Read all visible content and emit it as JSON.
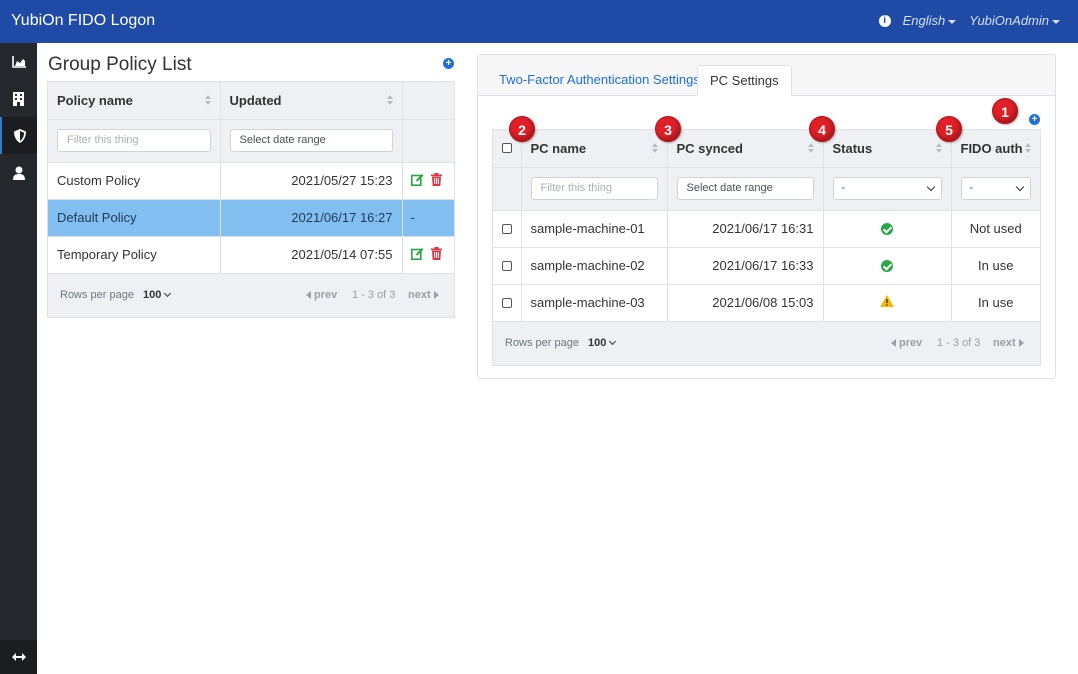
{
  "app": {
    "title": "YubiOn FIDO Logon"
  },
  "topnav": {
    "language": "English",
    "user": "YubiOnAdmin"
  },
  "left": {
    "title": "Group Policy List",
    "headers": {
      "name": "Policy name",
      "updated": "Updated"
    },
    "filters": {
      "name_placeholder": "Filter this thing",
      "updated_placeholder": "Select date range"
    },
    "rows": [
      {
        "name": "Custom Policy",
        "updated": "2021/05/27 15:23",
        "action": ""
      },
      {
        "name": "Default Policy",
        "updated": "2021/06/17 16:27",
        "action": "-"
      },
      {
        "name": "Temporary Policy",
        "updated": "2021/05/14 07:55",
        "action": ""
      }
    ],
    "footer": {
      "rows_per_page_label": "Rows per page",
      "rows_per_page": "100",
      "prev": "prev",
      "range": "1 - 3 of 3",
      "next": "next"
    }
  },
  "right": {
    "tabs": [
      "Two-Factor Authentication Settings",
      "PC Settings"
    ],
    "active_tab": "PC Settings",
    "headers": {
      "pc_name": "PC name",
      "pc_synced": "PC synced",
      "status": "Status",
      "fido_auth": "FIDO auth"
    },
    "filters": {
      "pc_name_placeholder": "Filter this thing",
      "synced_placeholder": "Select date range",
      "status_selected": "-",
      "fido_selected": "-"
    },
    "rows": [
      {
        "pc_name": "sample-machine-01",
        "synced": "2021/06/17 16:31",
        "status": "ok",
        "fido": "Not used"
      },
      {
        "pc_name": "sample-machine-02",
        "synced": "2021/06/17 16:33",
        "status": "ok",
        "fido": "In use"
      },
      {
        "pc_name": "sample-machine-03",
        "synced": "2021/06/08 15:03",
        "status": "warning",
        "fido": "In use"
      }
    ],
    "footer": {
      "rows_per_page_label": "Rows per page",
      "rows_per_page": "100",
      "prev": "prev",
      "range": "1 - 3 of 3",
      "next": "next"
    },
    "callouts": [
      "1",
      "2",
      "3",
      "4",
      "5"
    ]
  },
  "colors": {
    "topbar": "#1f4aa6",
    "sidebar": "#24272b",
    "selected_row": "#82bff0",
    "accent": "#1e6fe0",
    "callout": "#e01f26",
    "ok": "#28a745",
    "warning": "#f5b800",
    "delete": "#dc3545"
  }
}
